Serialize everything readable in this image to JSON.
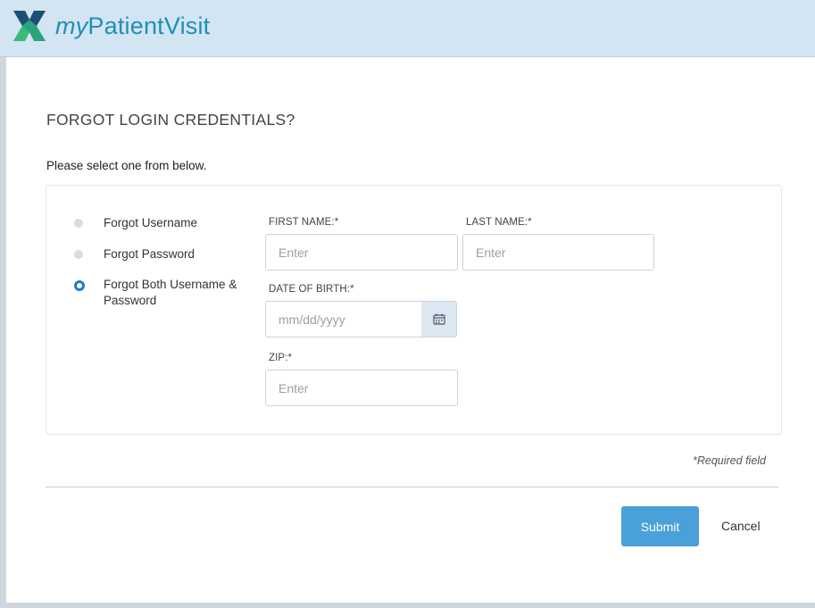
{
  "header": {
    "logo_prefix": "my",
    "logo_suffix": "PatientVisit",
    "brand_color": "#1f8fb6"
  },
  "page": {
    "title": "FORGOT LOGIN CREDENTIALS?",
    "subtitle": "Please select one from below."
  },
  "options": [
    {
      "label": "Forgot Username",
      "selected": false
    },
    {
      "label": "Forgot Password",
      "selected": false
    },
    {
      "label": "Forgot Both Username & Password",
      "selected": true
    }
  ],
  "form": {
    "first_name": {
      "label": "FIRST NAME:*",
      "placeholder": "Enter",
      "value": ""
    },
    "last_name": {
      "label": "LAST NAME:*",
      "placeholder": "Enter",
      "value": ""
    },
    "dob": {
      "label": "DATE OF BIRTH:*",
      "placeholder": "mm/dd/yyyy",
      "value": "",
      "icon": "calendar-icon"
    },
    "zip": {
      "label": "ZIP:*",
      "placeholder": "Enter",
      "value": ""
    }
  },
  "footer": {
    "required_note": "*Required field",
    "submit_label": "Submit",
    "cancel_label": "Cancel",
    "accent": "#4aa0d8",
    "radio_selected_color": "#1e7bd0"
  }
}
